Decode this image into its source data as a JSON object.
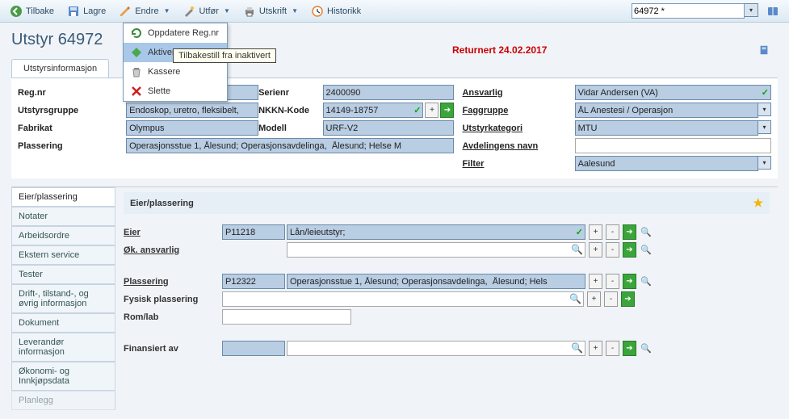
{
  "toolbar": {
    "back": "Tilbake",
    "save": "Lagre",
    "edit": "Endre",
    "execute": "Utfør",
    "print": "Utskrift",
    "history": "Historikk",
    "record_selector": "64972 *"
  },
  "edit_menu": {
    "update_regnr": "Oppdatere Reg.nr",
    "activate": "Aktivere",
    "discard": "Kassere",
    "delete": "Slette",
    "tooltip": "Tilbakestill fra inaktivert"
  },
  "title": "Utstyr 64972",
  "status": {
    "returnert": "Returnert 24.02.2017"
  },
  "main_tab": "Utstyrsinformasjon",
  "fields": {
    "regnr_label": "Reg.nr",
    "regnr_value": "64972",
    "serienr_label": "Serienr",
    "serienr_value": "2400090",
    "ansvarlig_label": "Ansvarlig",
    "ansvarlig_value": "Vidar Andersen (VA)",
    "utstyrsgruppe_label": "Utstyrsgruppe",
    "utstyrsgruppe_value": "Endoskop, uretro, fleksibelt,",
    "nkkn_label": "NKKN-Kode",
    "nkkn_value": "14149-18757",
    "faggruppe_label": "Faggruppe",
    "faggruppe_value": "ÅL Anestesi / Operasjon",
    "fabrikat_label": "Fabrikat",
    "fabrikat_value": "Olympus",
    "modell_label": "Modell",
    "modell_value": "URF-V2",
    "utstyrkategori_label": "Utstyrkategori",
    "utstyrkategori_value": "MTU",
    "plassering_label": "Plassering",
    "plassering_value": "Operasjonsstue 1, Ålesund; Operasjonsavdelinga,  Ålesund; Helse M",
    "avdelingens_label": "Avdelingens navn",
    "avdelingens_value": "",
    "filter_label": "Filter",
    "filter_value": "Aalesund"
  },
  "side_tabs": {
    "eier": "Eier/plassering",
    "notater": "Notater",
    "arbeidsordre": "Arbeidsordre",
    "ekstern": "Ekstern service",
    "tester": "Tester",
    "drift": "Drift-, tilstand-, og øvrig informasjon",
    "dokument": "Dokument",
    "leverandor": "Leverandør informasjon",
    "okonomi": "Økonomi- og Innkjøpsdata",
    "planlegg": "Planlegg"
  },
  "panel": {
    "header": "Eier/plassering",
    "eier_label": "Eier",
    "eier_code": "P11218",
    "eier_desc": "Lån/leieutstyr;",
    "ok_ansvarlig_label": "Øk. ansvarlig",
    "ok_ansvarlig_value": "",
    "plassering_label": "Plassering",
    "plassering_code": "P12322",
    "plassering_desc": "Operasjonsstue 1, Ålesund; Operasjonsavdelinga,  Ålesund; Hels",
    "fysisk_label": "Fysisk plassering",
    "fysisk_value": "",
    "romlab_label": "Rom/lab",
    "romlab_value": "",
    "finansiert_label": "Finansiert av",
    "finansiert_value": ""
  }
}
